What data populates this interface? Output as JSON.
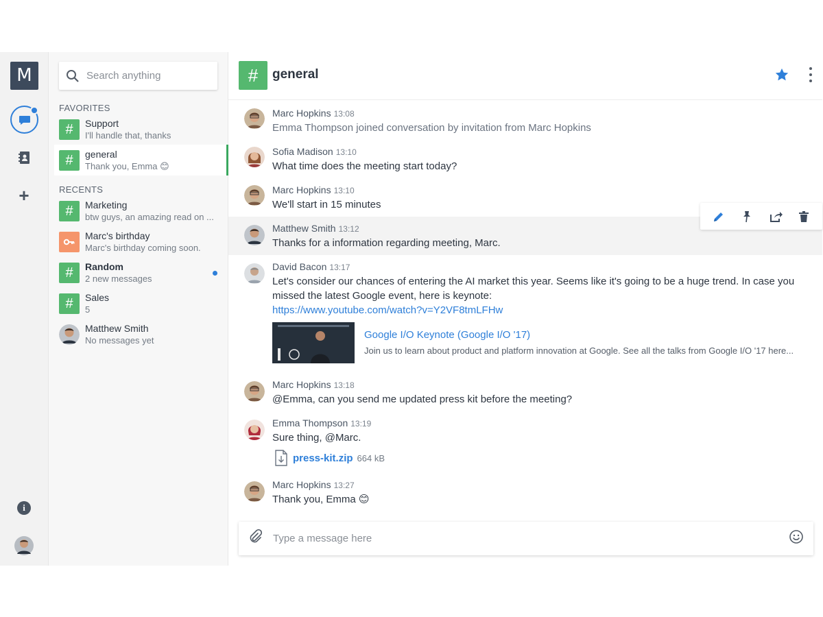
{
  "rail": {
    "logo_letter": "M",
    "icons": [
      "chat-icon",
      "contacts-icon",
      "plus-icon",
      "info-icon"
    ]
  },
  "sidebar": {
    "search": {
      "placeholder": "Search anything"
    },
    "favorites_label": "FAVORITES",
    "recents_label": "RECENTS",
    "favorites": [
      {
        "name": "Support",
        "preview": "I'll handle that, thanks",
        "icon": "#"
      },
      {
        "name": "general",
        "preview": "Thank you, Emma 😊",
        "icon": "#"
      }
    ],
    "recents": [
      {
        "name": "Marketing",
        "preview": "btw guys, an amazing read on ...",
        "icon": "#"
      },
      {
        "name": "Marc's birthday",
        "preview": "Marc's birthday coming soon.",
        "icon": "key-icon"
      },
      {
        "name": "Random",
        "preview": "2 new messages",
        "icon": "#"
      },
      {
        "name": "Sales",
        "preview": "5",
        "icon": "#"
      },
      {
        "name": "Matthew Smith",
        "preview": "No messages yet"
      }
    ]
  },
  "header": {
    "icon": "#",
    "title": "general"
  },
  "messages": [
    {
      "author": "Marc Hopkins",
      "time": "13:08",
      "text": "Emma Thompson joined conversation by invitation from Marc Hopkins"
    },
    {
      "author": "Sofia Madison",
      "time": "13:10",
      "text": "What time does the meeting start today?"
    },
    {
      "author": "Marc Hopkins",
      "time": "13:10",
      "text": "We'll start in 15 minutes"
    },
    {
      "author": "Matthew Smith",
      "time": "13:12",
      "text": "Thanks for a information regarding meeting, Marc."
    },
    {
      "author": "David Bacon",
      "time": "13:17",
      "text": "Let's consider our chances of entering the AI market this year. Seems like it's going to be a huge trend. In case you missed the latest Google event, here is keynote:",
      "link": "https://www.youtube.com/watch?v=Y2VF8tmLFHw"
    },
    {
      "author": "Marc Hopkins",
      "time": "13:18",
      "text": "@Emma, can you send me updated press kit before the meeting?"
    },
    {
      "author": "Emma Thompson",
      "time": "13:19",
      "text": "Sure thing, @Marc."
    },
    {
      "author": "Marc Hopkins",
      "time": "13:27",
      "text": "Thank you, Emma 😊"
    }
  ],
  "link_preview": {
    "title": "Google I/O Keynote (Google I/O '17)",
    "description": "Join us to learn about product and platform innovation at Google. See all the talks from Google I/O '17 here..."
  },
  "attachment": {
    "name": "press-kit.zip",
    "size": "664 kB"
  },
  "composer": {
    "placeholder": "Type a message here"
  },
  "colors": {
    "accent": "#2e7fd9",
    "room_green": "#55b86f",
    "room_orange": "#f5956b",
    "rail_dark": "#3d4a5c"
  }
}
